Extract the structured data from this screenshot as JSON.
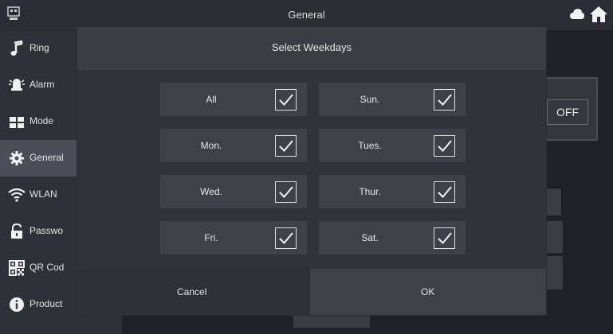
{
  "header": {
    "title": "General",
    "icons": [
      "device-icon",
      "cloud-icon",
      "home-icon"
    ]
  },
  "sidebar": {
    "items": [
      {
        "label": "Ring",
        "icon": "music-note-icon",
        "active": false
      },
      {
        "label": "Alarm",
        "icon": "alarm-icon",
        "active": false
      },
      {
        "label": "Mode",
        "icon": "mode-icon",
        "active": false
      },
      {
        "label": "General",
        "icon": "gear-icon",
        "active": true
      },
      {
        "label": "WLAN",
        "icon": "wifi-icon",
        "active": false
      },
      {
        "label": "Passwo",
        "icon": "lock-icon",
        "active": false
      },
      {
        "label": "QR Cod",
        "icon": "qr-code-icon",
        "active": false
      },
      {
        "label": "Product",
        "icon": "info-icon",
        "active": false
      }
    ]
  },
  "background": {
    "toggle_label": "OFF"
  },
  "modal": {
    "title": "Select Weekdays",
    "days": [
      {
        "label": "All",
        "checked": true
      },
      {
        "label": "Sun.",
        "checked": true
      },
      {
        "label": "Mon.",
        "checked": true
      },
      {
        "label": "Tues.",
        "checked": true
      },
      {
        "label": "Wed.",
        "checked": true
      },
      {
        "label": "Thur.",
        "checked": true
      },
      {
        "label": "Fri.",
        "checked": true
      },
      {
        "label": "Sat.",
        "checked": true
      }
    ],
    "cancel_label": "Cancel",
    "ok_label": "OK"
  },
  "colors": {
    "background": "#1f2228",
    "panel": "#393c43",
    "cell": "#3e4148",
    "active": "#4a4e57",
    "text": "#e6e6e6"
  }
}
